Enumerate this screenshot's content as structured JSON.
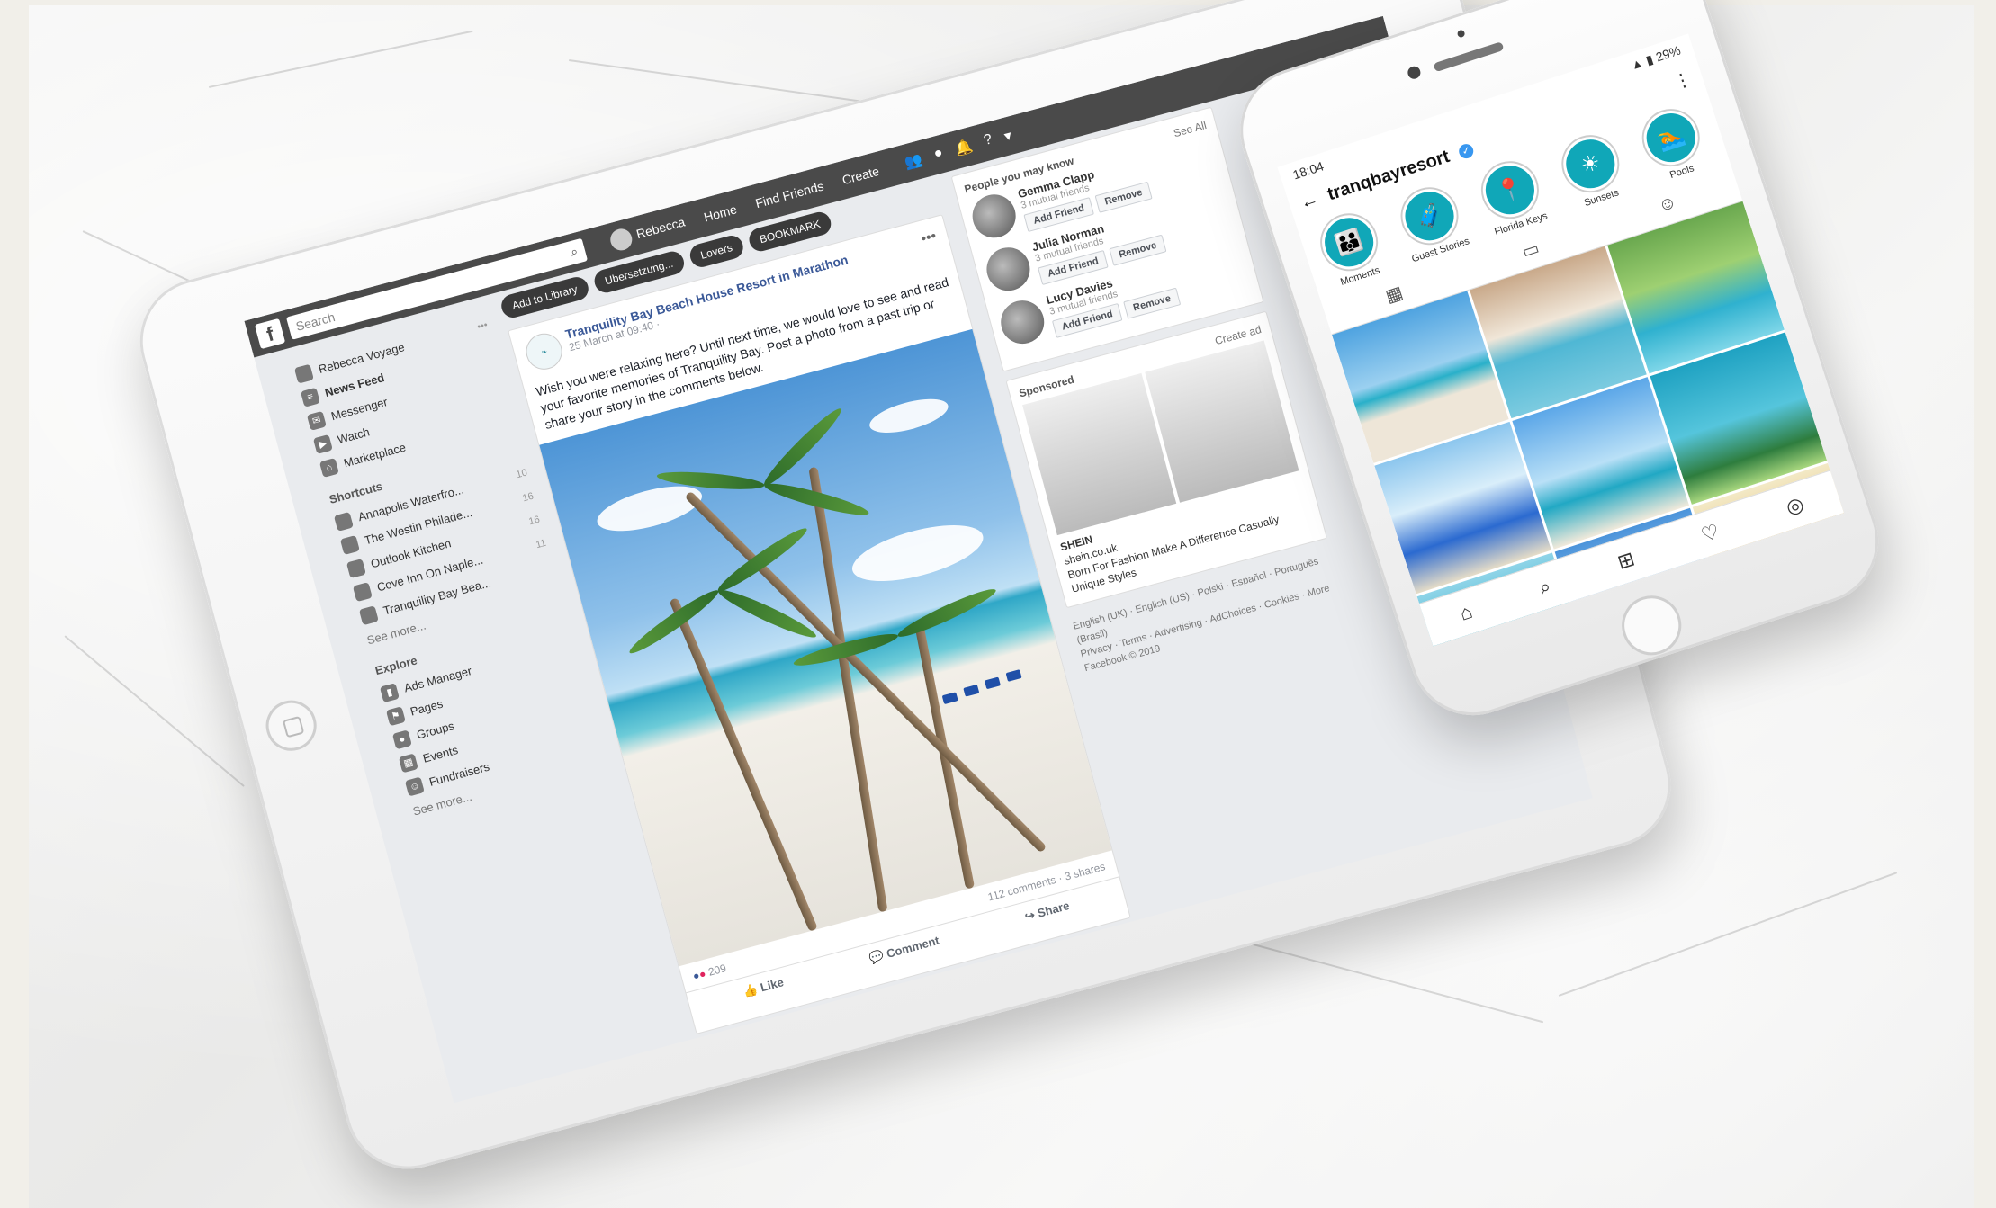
{
  "facebook": {
    "search_placeholder": "Search",
    "nav": {
      "user": "Rebecca",
      "home": "Home",
      "find_friends": "Find Friends",
      "create": "Create"
    },
    "left_nav": {
      "user": "Rebecca Voyage",
      "items": [
        "News Feed",
        "Messenger",
        "Watch",
        "Marketplace"
      ],
      "shortcuts_header": "Shortcuts",
      "shortcuts": [
        {
          "label": "Annapolis Waterfro...",
          "count": "10"
        },
        {
          "label": "The Westin Philade...",
          "count": "16"
        },
        {
          "label": "Outlook Kitchen",
          "count": "16"
        },
        {
          "label": "Cove Inn On Naple...",
          "count": "11"
        },
        {
          "label": "Tranquility Bay Bea...",
          "count": ""
        }
      ],
      "see_more": "See more...",
      "explore_header": "Explore",
      "explore": [
        "Ads Manager",
        "Pages",
        "Groups",
        "Events",
        "Fundraisers"
      ],
      "see_more_2": "See more..."
    },
    "chips": [
      "Add to Library",
      "Ubersetzung...",
      "Lovers",
      "BOOKMARK"
    ],
    "post": {
      "page_name": "Tranquility Bay Beach House Resort in Marathon",
      "date": "25 March at 09:40 ·",
      "text": "Wish you were relaxing here? Until next time, we would love to see and read your favorite memories of Tranquility Bay. Post a photo from a past trip or share your story in the comments below.",
      "reactions": "209",
      "comments": "112 comments",
      "shares": "3 shares",
      "like": "Like",
      "comment": "Comment",
      "share": "Share"
    },
    "people": {
      "title": "People you may know",
      "see_all": "See All",
      "list": [
        {
          "name": "Gemma Clapp",
          "mutual": "3 mutual friends"
        },
        {
          "name": "Julia Norman",
          "mutual": "3 mutual friends"
        },
        {
          "name": "Lucy Davies",
          "mutual": "3 mutual friends"
        }
      ],
      "add_friend": "Add Friend",
      "remove": "Remove"
    },
    "sponsored": {
      "title": "Sponsored",
      "create_ad": "Create ad",
      "brand": "SHEIN",
      "domain": "shein.co.uk",
      "tagline": "Born For Fashion Make A Difference Casually Unique Styles"
    },
    "footer": {
      "languages": "English (UK) · English (US) · Polski · Español · Português (Brasil)",
      "links": "Privacy · Terms · Advertising · AdChoices · Cookies · More",
      "copyright": "Facebook © 2019"
    }
  },
  "instagram": {
    "time": "18:04",
    "battery": "29%",
    "username": "tranqbayresort",
    "highlights": [
      "Moments",
      "Guest Stories",
      "Florida Keys",
      "Sunsets",
      "Pools"
    ]
  }
}
